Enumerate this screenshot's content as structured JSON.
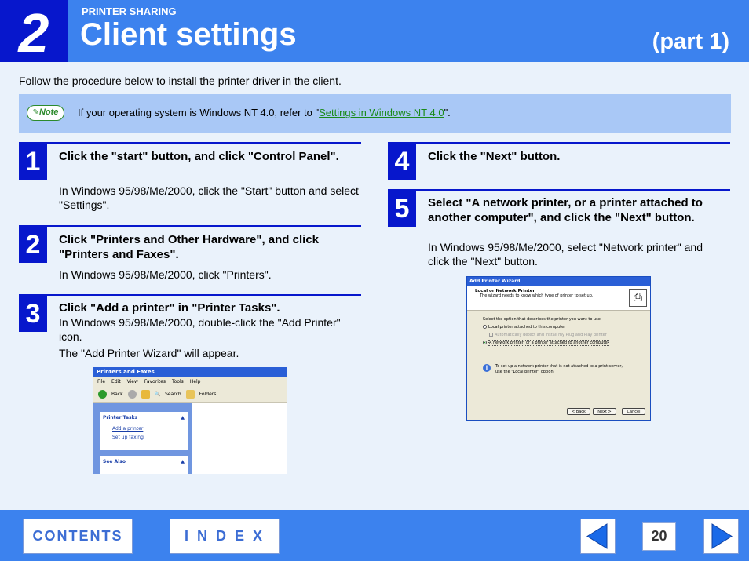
{
  "header": {
    "chapter_number": "2",
    "section_label": "PRINTER SHARING",
    "title": "Client settings",
    "part": "(part 1)"
  },
  "intro": "Follow the procedure below to install the printer driver in the client.",
  "note": {
    "badge": "Note",
    "text_before": "If your operating system is Windows NT 4.0, refer to \"",
    "link": "Settings in Windows NT 4.0",
    "text_after": "\"."
  },
  "steps": [
    {
      "number": "1",
      "title": "Click the \"start\" button, and click \"Control Panel\".",
      "body": "In Windows 95/98/Me/2000, click the \"Start\" button and select \"Settings\"."
    },
    {
      "number": "2",
      "title": "Click \"Printers and Other Hardware\", and click \"Printers and Faxes\".",
      "body": "In Windows 95/98/Me/2000, click \"Printers\"."
    },
    {
      "number": "3",
      "title": "Click \"Add a printer\" in \"Printer Tasks\".",
      "body": "In Windows 95/98/Me/2000, double-click the \"Add Printer\" icon.",
      "body2": "The \"Add Printer Wizard\" will appear."
    },
    {
      "number": "4",
      "title": "Click the \"Next\" button."
    },
    {
      "number": "5",
      "title": "Select \"A network printer, or a printer attached to another computer\", and click the \"Next\" button.",
      "body": "In Windows 95/98/Me/2000, select \"Network printer\" and click the \"Next\" button."
    }
  ],
  "printers_window": {
    "title": "Printers and Faxes",
    "menu": [
      "File",
      "Edit",
      "View",
      "Favorites",
      "Tools",
      "Help"
    ],
    "toolbar": [
      "Back",
      "Search",
      "Folders"
    ],
    "printer_tasks_header": "Printer Tasks",
    "tasks": [
      "Add a printer",
      "Set up faxing"
    ],
    "see_also_header": "See Also"
  },
  "wizard": {
    "title": "Add Printer Wizard",
    "heading": "Local or Network Printer",
    "subheading": "The wizard needs to know which type of printer to set up.",
    "prompt": "Select the option that describes the printer you want to use:",
    "option_local": "Local printer attached to this computer",
    "option_auto": "Automatically detect and install my Plug and Play printer",
    "option_network": "A network printer, or a printer attached to another computer",
    "info_line1": "To set up a network printer that is not attached to a print server,",
    "info_line2": "use the \"Local printer\" option.",
    "btn_back": "< Back",
    "btn_next": "Next >",
    "btn_cancel": "Cancel"
  },
  "footer": {
    "contents": "CONTENTS",
    "index": "I N D E X",
    "page": "20"
  },
  "colors": {
    "primary_blue": "#3c82ee",
    "dark_blue": "#0717cc",
    "note_bg": "#a9c8f6",
    "page_bg": "#eaf2fb"
  }
}
